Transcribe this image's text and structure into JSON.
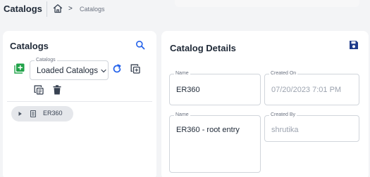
{
  "header": {
    "title": "Catalogs",
    "breadcrumb": {
      "home_icon": "home-icon",
      "separator": ">",
      "current": "Catalogs"
    }
  },
  "catalogs_panel": {
    "title": "Catalogs",
    "select": {
      "label": "Catalogs",
      "value": "Loaded Catalogs"
    },
    "icons": [
      "search-icon",
      "add-icon",
      "refresh-icon",
      "copy-icon",
      "delete-icon",
      "chevron-down-icon"
    ],
    "tree": [
      {
        "label": "ER360",
        "expanded": false
      }
    ]
  },
  "details_panel": {
    "title": "Catalog Details",
    "fields": {
      "name": {
        "label": "Name",
        "value": "ER360"
      },
      "created_on": {
        "label": "Created On",
        "value": "07/20/2023 7:01 PM"
      },
      "description": {
        "label": "Name",
        "value": "ER360 - root entry"
      },
      "created_by": {
        "label": "Created By",
        "value": "shrutika"
      }
    }
  },
  "colors": {
    "accent": "#2563eb",
    "add_green": "#22a34a",
    "text_dark": "#1f2937",
    "muted": "#9ca3af",
    "background": "#f3f4f6"
  }
}
